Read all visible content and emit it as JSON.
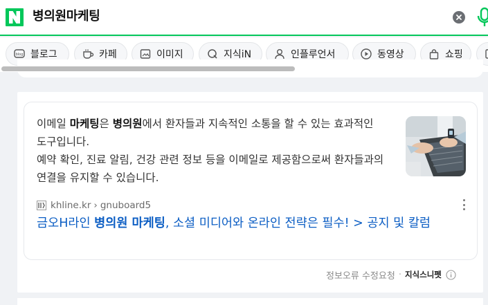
{
  "search": {
    "logo_letter": "N",
    "query": "병의원마케팅"
  },
  "tabs": [
    {
      "label": "블로그",
      "icon": "blog-icon"
    },
    {
      "label": "카페",
      "icon": "cafe-icon"
    },
    {
      "label": "이미지",
      "icon": "image-icon"
    },
    {
      "label": "지식iN",
      "icon": "kin-icon"
    },
    {
      "label": "인플루언서",
      "icon": "influencer-icon"
    },
    {
      "label": "동영상",
      "icon": "video-icon"
    },
    {
      "label": "쇼핑",
      "icon": "shopping-icon"
    }
  ],
  "result": {
    "snippet_parts": [
      {
        "text": "이메일 ",
        "bold": false
      },
      {
        "text": "마케팅",
        "bold": true
      },
      {
        "text": "은 ",
        "bold": false
      },
      {
        "text": "병의원",
        "bold": true
      },
      {
        "text": "에서 환자들과 지속적인 소통을 할 수 있는 효과적인 도구입니다.",
        "bold": false
      }
    ],
    "snippet_line2": "예약 확인, 진료 알림, 건강 관련 정보 등을 이메일로 제공함으로써 환자들과의 연결을 유지할 수 있습니다.",
    "source_domain": "khline.kr",
    "source_sep": "›",
    "source_path": "gnuboard5",
    "title_parts": [
      {
        "text": "금오H라인 ",
        "bold": false
      },
      {
        "text": "병의원 마케팅",
        "bold": true
      },
      {
        "text": ", 소셜 미디어와 온라인 전략은 필수! > 공지 및 칼럼",
        "bold": false
      }
    ]
  },
  "footer": {
    "report_label": "정보오류 수정요청",
    "separator": "·",
    "snippet_label": "지식스니펫"
  },
  "colors": {
    "brand": "#03c75a",
    "link": "#0c5ec4",
    "text": "#333333",
    "muted": "#8a8a8a"
  }
}
